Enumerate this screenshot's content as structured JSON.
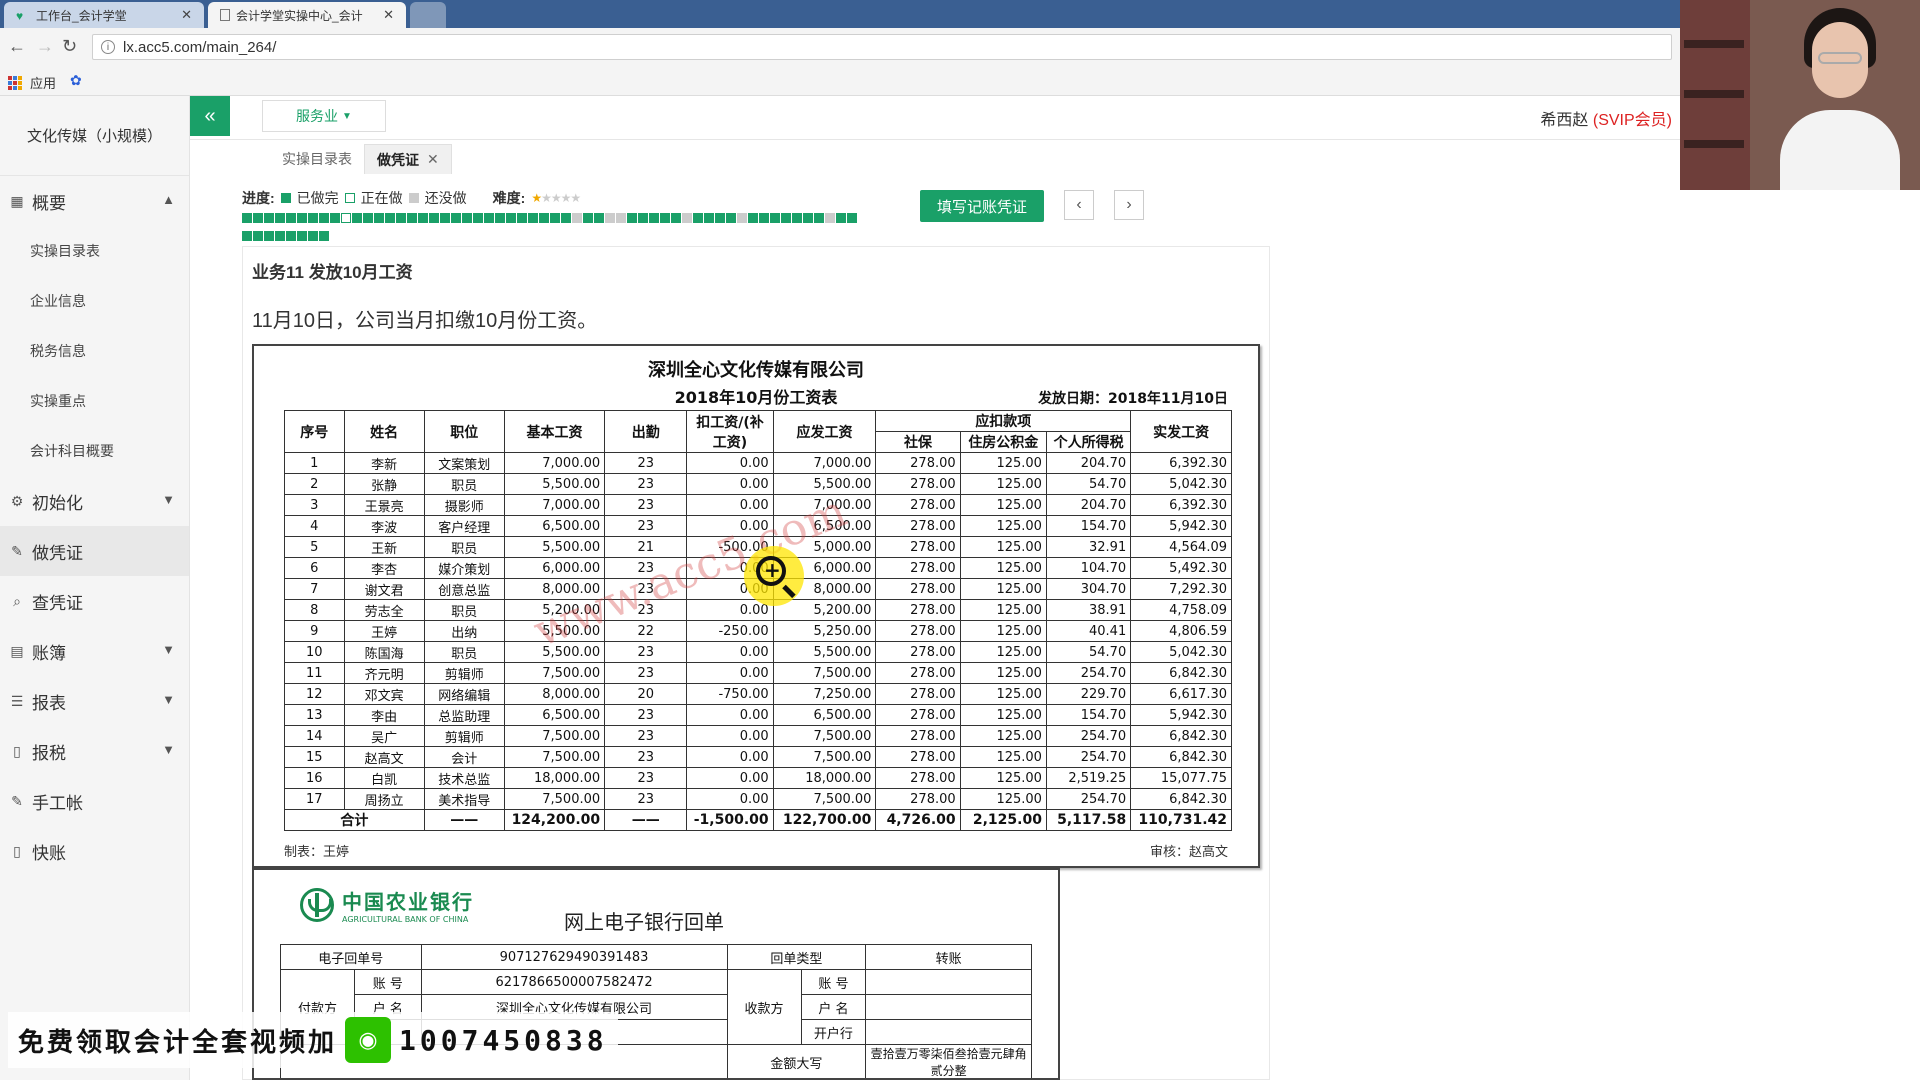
{
  "browser": {
    "tabs": [
      {
        "title": "工作台_会计学堂",
        "active": false
      },
      {
        "title": "会计学堂实操中心_会计",
        "active": true
      }
    ],
    "url": "lx.acc5.com/main_264/",
    "bookmarks_label": "应用"
  },
  "app": {
    "company_name": "文化传媒（小规模）",
    "industry_dropdown": "服务业",
    "user_name": "希西赵",
    "user_level": "(SVIP会员)",
    "collapse_icon": "«",
    "page_tabs": [
      {
        "label": "实操目录表",
        "active": false
      },
      {
        "label": "做凭证",
        "active": true,
        "closable": true
      }
    ],
    "sidebar": [
      {
        "label": "概要",
        "icon": "grid-icon",
        "expanded": true,
        "sub": [
          "实操目录表",
          "企业信息",
          "税务信息",
          "实操重点",
          "会计科目概要"
        ]
      },
      {
        "label": "初始化",
        "icon": "gear-icon",
        "expanded": false
      },
      {
        "label": "做凭证",
        "icon": "pencil-icon",
        "active": true
      },
      {
        "label": "查凭证",
        "icon": "search-icon"
      },
      {
        "label": "账簿",
        "icon": "book-icon",
        "expanded": false
      },
      {
        "label": "报表",
        "icon": "list-icon",
        "expanded": false
      },
      {
        "label": "报税",
        "icon": "file-icon",
        "expanded": false
      },
      {
        "label": "手工帐",
        "icon": "pencil-icon"
      },
      {
        "label": "快账",
        "icon": "file-icon"
      }
    ],
    "progress": {
      "label": "进度:",
      "legend": [
        "已做完",
        "正在做",
        "还没做"
      ],
      "difficulty_label": "难度:",
      "difficulty_rating": 1,
      "difficulty_max": 5,
      "done_color": "#1aa068",
      "doing_color": "#ffffff",
      "todo_color": "#cccccc"
    },
    "fill_button": "填写记账凭证",
    "biz_title": "业务11 发放10月工资",
    "biz_desc": "11月10日，公司当月扣缴10月份工资。"
  },
  "payroll": {
    "company": "深圳全心文化传媒有限公司",
    "title": "2018年10月份工资表",
    "date": "发放日期：2018年11月10日",
    "headers": {
      "seq": "序号",
      "name": "姓名",
      "position": "职位",
      "base": "基本工资",
      "attendance": "出勤",
      "deduct": "扣工资/(补工资)",
      "payable": "应发工资",
      "withhold": "应扣款项",
      "social": "社保",
      "fund": "住房公积金",
      "tax": "个人所得税",
      "net": "实发工资"
    },
    "rows": [
      [
        "1",
        "李新",
        "文案策划",
        "7,000.00",
        "23",
        "0.00",
        "7,000.00",
        "278.00",
        "125.00",
        "204.70",
        "6,392.30"
      ],
      [
        "2",
        "张静",
        "职员",
        "5,500.00",
        "23",
        "0.00",
        "5,500.00",
        "278.00",
        "125.00",
        "54.70",
        "5,042.30"
      ],
      [
        "3",
        "王景亮",
        "摄影师",
        "7,000.00",
        "23",
        "0.00",
        "7,000.00",
        "278.00",
        "125.00",
        "204.70",
        "6,392.30"
      ],
      [
        "4",
        "李波",
        "客户经理",
        "6,500.00",
        "23",
        "0.00",
        "6,500.00",
        "278.00",
        "125.00",
        "154.70",
        "5,942.30"
      ],
      [
        "5",
        "王新",
        "职员",
        "5,500.00",
        "21",
        "-500.00",
        "5,000.00",
        "278.00",
        "125.00",
        "32.91",
        "4,564.09"
      ],
      [
        "6",
        "李杏",
        "媒介策划",
        "6,000.00",
        "23",
        "0.00",
        "6,000.00",
        "278.00",
        "125.00",
        "104.70",
        "5,492.30"
      ],
      [
        "7",
        "谢文君",
        "创意总监",
        "8,000.00",
        "23",
        "0.00",
        "8,000.00",
        "278.00",
        "125.00",
        "304.70",
        "7,292.30"
      ],
      [
        "8",
        "劳志全",
        "职员",
        "5,200.00",
        "23",
        "0.00",
        "5,200.00",
        "278.00",
        "125.00",
        "38.91",
        "4,758.09"
      ],
      [
        "9",
        "王婷",
        "出纳",
        "5,500.00",
        "22",
        "-250.00",
        "5,250.00",
        "278.00",
        "125.00",
        "40.41",
        "4,806.59"
      ],
      [
        "10",
        "陈国海",
        "职员",
        "5,500.00",
        "23",
        "0.00",
        "5,500.00",
        "278.00",
        "125.00",
        "54.70",
        "5,042.30"
      ],
      [
        "11",
        "齐元明",
        "剪辑师",
        "7,500.00",
        "23",
        "0.00",
        "7,500.00",
        "278.00",
        "125.00",
        "254.70",
        "6,842.30"
      ],
      [
        "12",
        "邓文宾",
        "网络编辑",
        "8,000.00",
        "20",
        "-750.00",
        "7,250.00",
        "278.00",
        "125.00",
        "229.70",
        "6,617.30"
      ],
      [
        "13",
        "李由",
        "总监助理",
        "6,500.00",
        "23",
        "0.00",
        "6,500.00",
        "278.00",
        "125.00",
        "154.70",
        "5,942.30"
      ],
      [
        "14",
        "吴广",
        "剪辑师",
        "7,500.00",
        "23",
        "0.00",
        "7,500.00",
        "278.00",
        "125.00",
        "254.70",
        "6,842.30"
      ],
      [
        "15",
        "赵高文",
        "会计",
        "7,500.00",
        "23",
        "0.00",
        "7,500.00",
        "278.00",
        "125.00",
        "254.70",
        "6,842.30"
      ],
      [
        "16",
        "白凯",
        "技术总监",
        "18,000.00",
        "23",
        "0.00",
        "18,000.00",
        "278.00",
        "125.00",
        "2,519.25",
        "15,077.75"
      ],
      [
        "17",
        "周扬立",
        "美术指导",
        "7,500.00",
        "23",
        "0.00",
        "7,500.00",
        "278.00",
        "125.00",
        "254.70",
        "6,842.30"
      ]
    ],
    "total": [
      "合计",
      "——",
      "124,200.00",
      "——",
      "-1,500.00",
      "122,700.00",
      "4,726.00",
      "2,125.00",
      "5,117.58",
      "110,731.42"
    ],
    "maker": "制表：王婷",
    "auditor": "审核：赵高文",
    "watermark": "www.acc5.com"
  },
  "bank": {
    "name_cn": "中国农业银行",
    "name_en": "AGRICULTURAL BANK OF CHINA",
    "title": "网上电子银行回单",
    "receipt_no_label": "电子回单号",
    "receipt_no": "907127629490391483",
    "type_label": "回单类型",
    "type_value": "转账",
    "payer_label": "付款方",
    "payee_label": "收款方",
    "account_label": "账 号",
    "payer_account": "6217866500007582472",
    "name_label": "户 名",
    "payer_name": "深圳全心文化传媒有限公司",
    "bank_label": "开户行",
    "amount_label": "金额大写",
    "amount_text": "壹拾壹万零柒佰叁拾壹元肆角贰分整"
  },
  "promo": {
    "text": "免费领取会计全套视频加",
    "number": "1007450838"
  }
}
